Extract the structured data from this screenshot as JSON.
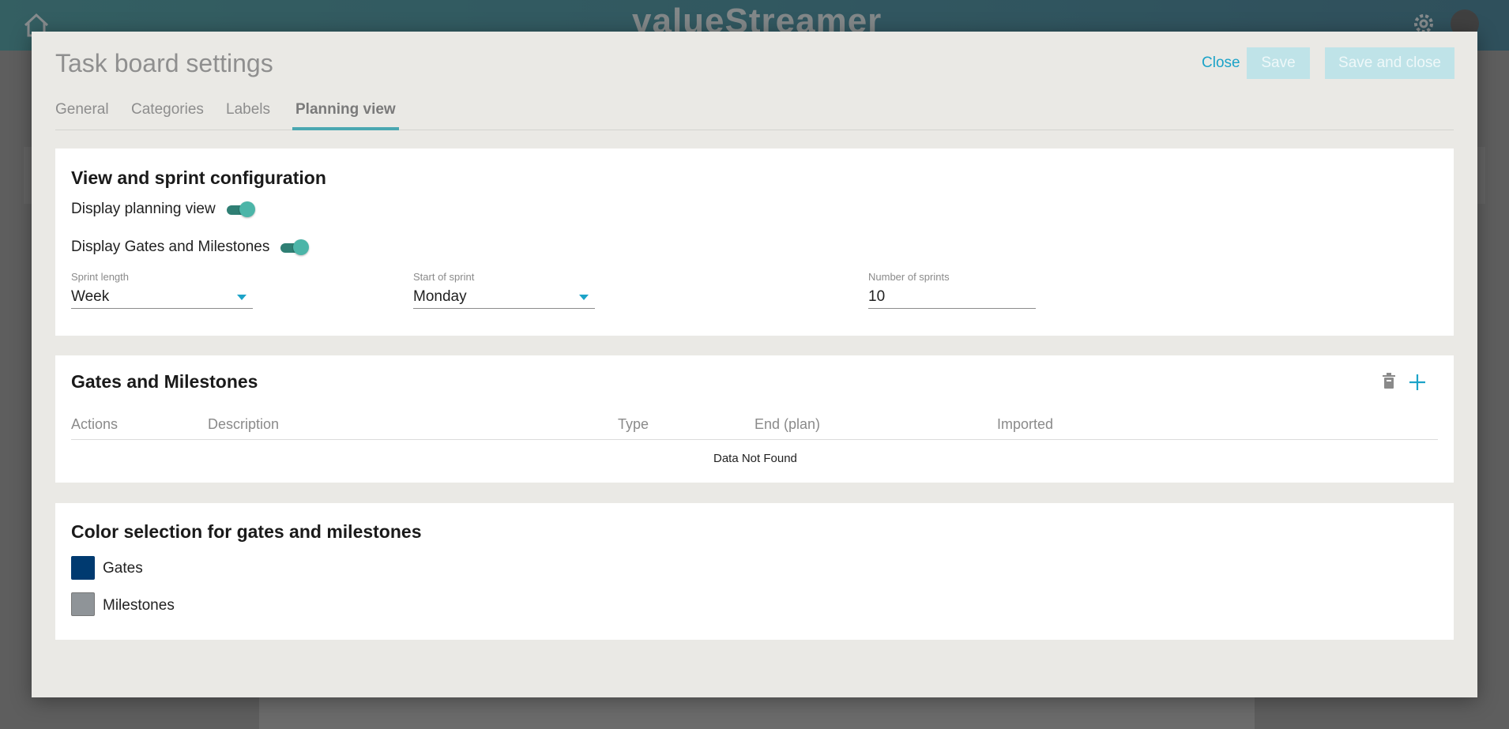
{
  "background": {
    "logo_text": "valueStreamer",
    "header_gradient": [
      "#1f7e85",
      "#165d78"
    ]
  },
  "modal": {
    "title": "Task board settings",
    "actions": {
      "close_label": "Close",
      "save_label": "Save",
      "save_close_label": "Save and close"
    },
    "tabs": [
      {
        "label": "General",
        "active": false
      },
      {
        "label": "Categories",
        "active": false
      },
      {
        "label": "Labels",
        "active": false
      },
      {
        "label": "Planning view",
        "active": true
      }
    ]
  },
  "view_config": {
    "title": "View and sprint configuration",
    "display_planning_view": {
      "label": "Display planning view",
      "enabled": true
    },
    "display_gates": {
      "label": "Display Gates and Milestones",
      "enabled": true
    },
    "sprint_length": {
      "label": "Sprint length",
      "value": "Week"
    },
    "start_of_sprint": {
      "label": "Start of sprint",
      "value": "Monday"
    },
    "number_of_sprints": {
      "label": "Number of sprints",
      "value": "10"
    }
  },
  "gates": {
    "title": "Gates and Milestones",
    "columns": [
      "Actions",
      "Description",
      "Type",
      "End (plan)",
      "Imported"
    ],
    "empty_message": "Data Not Found"
  },
  "colors": {
    "title": "Color selection for gates and milestones",
    "items": [
      {
        "label": "Gates",
        "color": "#003a70"
      },
      {
        "label": "Milestones",
        "color": "#8f9498"
      }
    ]
  },
  "theme": {
    "accent": "#1ca3c8",
    "tab_underline": "#4aa7b1",
    "toggle_on": "#4cb5a8",
    "disabled_button": "#bfe3e8"
  }
}
